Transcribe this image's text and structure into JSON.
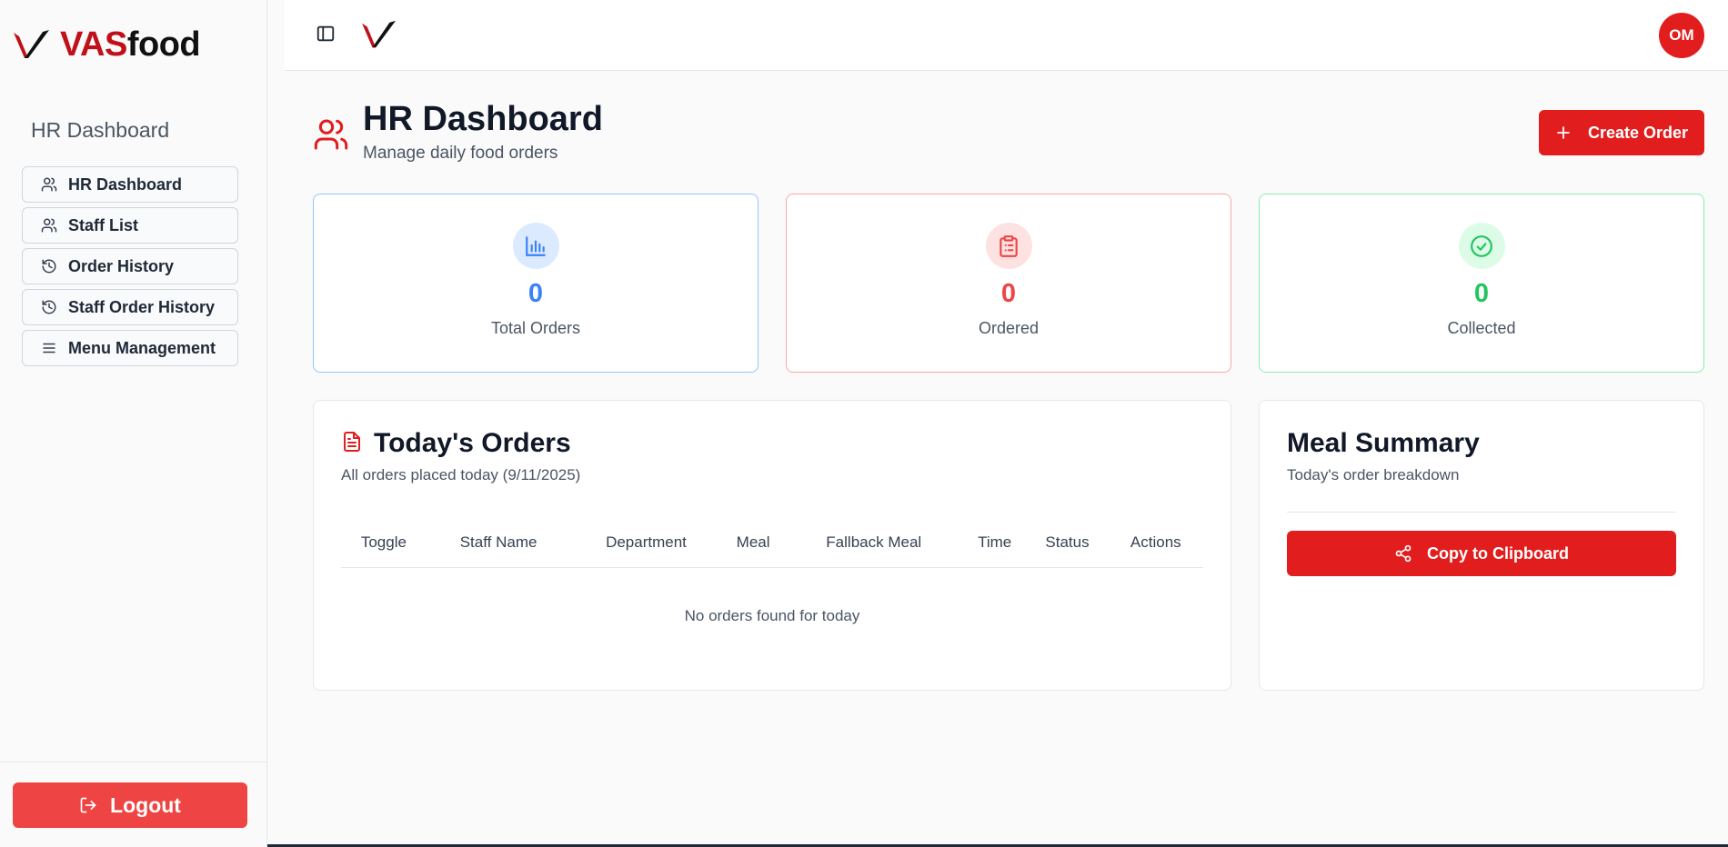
{
  "brand": {
    "name_part1": "VAS",
    "name_part2": "food"
  },
  "sidebar": {
    "heading": "HR Dashboard",
    "items": [
      {
        "label": "HR Dashboard",
        "icon": "users-icon"
      },
      {
        "label": "Staff List",
        "icon": "users-icon"
      },
      {
        "label": "Order History",
        "icon": "history-icon"
      },
      {
        "label": "Staff Order History",
        "icon": "history-icon"
      },
      {
        "label": "Menu Management",
        "icon": "menu-icon"
      }
    ],
    "logout_label": "Logout"
  },
  "topbar": {
    "avatar_initials": "OM"
  },
  "header": {
    "title": "HR Dashboard",
    "subtitle": "Manage daily food orders",
    "create_label": "Create Order"
  },
  "stats": [
    {
      "value": "0",
      "label": "Total Orders",
      "color": "#3b82f6",
      "icon": "bar-chart-icon"
    },
    {
      "value": "0",
      "label": "Ordered",
      "color": "#ef4444",
      "icon": "clipboard-icon"
    },
    {
      "value": "0",
      "label": "Collected",
      "color": "#22c55e",
      "icon": "check-circle-icon"
    }
  ],
  "orders": {
    "title": "Today's Orders",
    "subtitle": "All orders placed today (9/11/2025)",
    "columns": [
      "Toggle",
      "Staff Name",
      "Department",
      "Meal",
      "Fallback Meal",
      "Time",
      "Status",
      "Actions"
    ],
    "empty_text": "No orders found for today"
  },
  "summary": {
    "title": "Meal Summary",
    "subtitle": "Today's order breakdown",
    "copy_label": "Copy to Clipboard"
  },
  "colors": {
    "accent": "#e11d1d",
    "logout": "#ef4444"
  }
}
